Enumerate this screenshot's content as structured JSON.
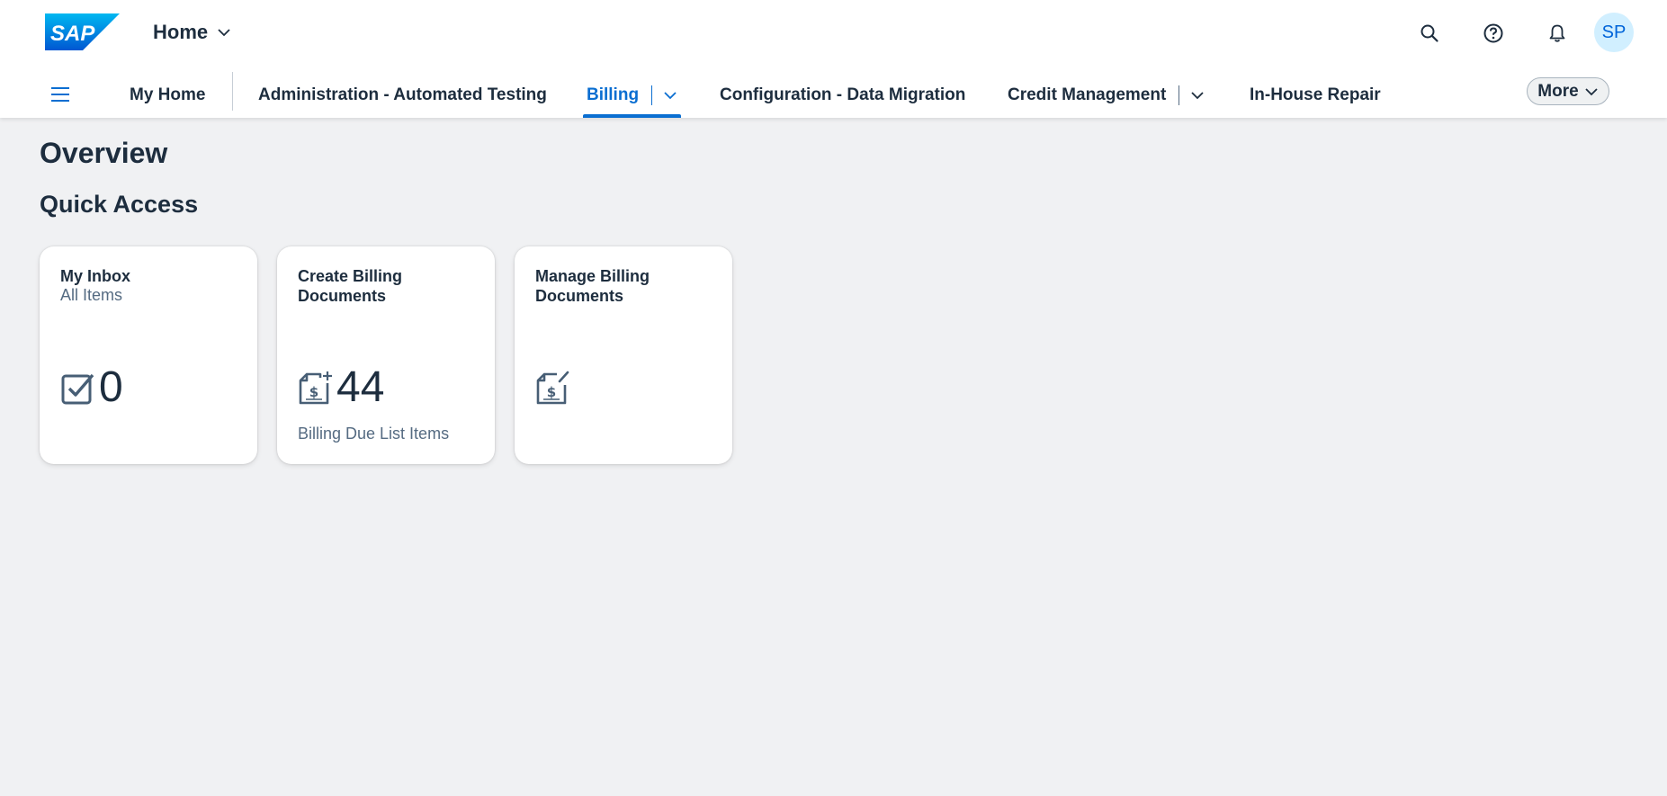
{
  "header": {
    "logo_text": "SAP",
    "home_label": "Home",
    "avatar_initials": "SP",
    "colors": {
      "brand": "#0a6ed1",
      "avatar_bg": "#d1efff"
    }
  },
  "nav": {
    "items": [
      {
        "label": "My Home"
      },
      {
        "label": "Administration - Automated Testing"
      },
      {
        "label": "Billing"
      },
      {
        "label": "Configuration - Data Migration"
      },
      {
        "label": "Credit Management"
      },
      {
        "label": "In-House Repair"
      }
    ],
    "active": "Billing",
    "more_label": "More"
  },
  "page": {
    "title": "Overview",
    "section_title": "Quick Access"
  },
  "tiles": [
    {
      "title": "My Inbox",
      "subtitle": "All Items",
      "icon": "task-check-icon",
      "count": "0",
      "footer": ""
    },
    {
      "title": "Create Billing Documents",
      "subtitle": "",
      "icon": "billing-document-add-icon",
      "count": "44",
      "footer": "Billing Due List Items"
    },
    {
      "title": "Manage Billing Documents",
      "subtitle": "",
      "icon": "billing-document-edit-icon",
      "count": "",
      "footer": ""
    }
  ]
}
